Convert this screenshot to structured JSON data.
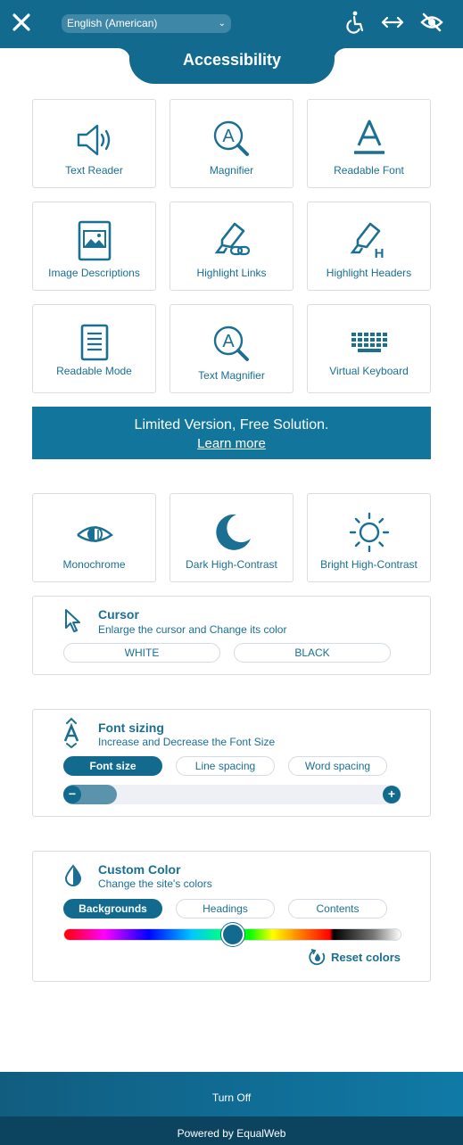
{
  "header": {
    "close_icon": "close-icon",
    "language": "English (American)",
    "title": "Accessibility",
    "icons": [
      "wheelchair-icon",
      "resize-arrows-icon",
      "hide-eye-icon"
    ]
  },
  "features": [
    {
      "label": "Text Reader",
      "icon": "speaker-icon"
    },
    {
      "label": "Magnifier",
      "icon": "magnifier-icon"
    },
    {
      "label": "Readable Font",
      "icon": "font-icon"
    },
    {
      "label": "Image Descriptions",
      "icon": "image-icon"
    },
    {
      "label": "Highlight Links",
      "icon": "highlight-links-icon"
    },
    {
      "label": "Highlight Headers",
      "icon": "highlight-headers-icon"
    },
    {
      "label": "Readable Mode",
      "icon": "document-icon"
    },
    {
      "label": "Text Magnifier",
      "icon": "text-magnifier-icon"
    },
    {
      "label": "Virtual Keyboard",
      "icon": "keyboard-icon"
    }
  ],
  "banner": {
    "title": "Limited Version, Free Solution.",
    "link": "Learn more"
  },
  "contrast": [
    {
      "label": "Monochrome",
      "icon": "monochrome-eye-icon"
    },
    {
      "label": "Dark High-Contrast",
      "icon": "moon-icon"
    },
    {
      "label": "Bright High-Contrast",
      "icon": "sun-icon"
    }
  ],
  "cursor": {
    "title": "Cursor",
    "subtitle": "Enlarge the cursor and Change its color",
    "options": [
      "WHITE",
      "BLACK"
    ]
  },
  "font_sizing": {
    "title": "Font sizing",
    "subtitle": "Increase and Decrease the Font Size",
    "tabs": [
      "Font size",
      "Line spacing",
      "Word spacing"
    ],
    "active_tab": "Font size",
    "minus": "−",
    "plus": "+",
    "level": 0.12
  },
  "custom_color": {
    "title": "Custom Color",
    "subtitle": "Change the site's colors",
    "tabs": [
      "Backgrounds",
      "Headings",
      "Contents"
    ],
    "active_tab": "Backgrounds",
    "slider_value": 0.5,
    "reset": "Reset colors"
  },
  "footer": {
    "turn_off": "Turn Off",
    "powered_by": "Powered by EqualWeb"
  },
  "colors": {
    "primary": "#126b8f",
    "accent_text": "#1a6f93",
    "footer_dark": "#0c4460"
  }
}
